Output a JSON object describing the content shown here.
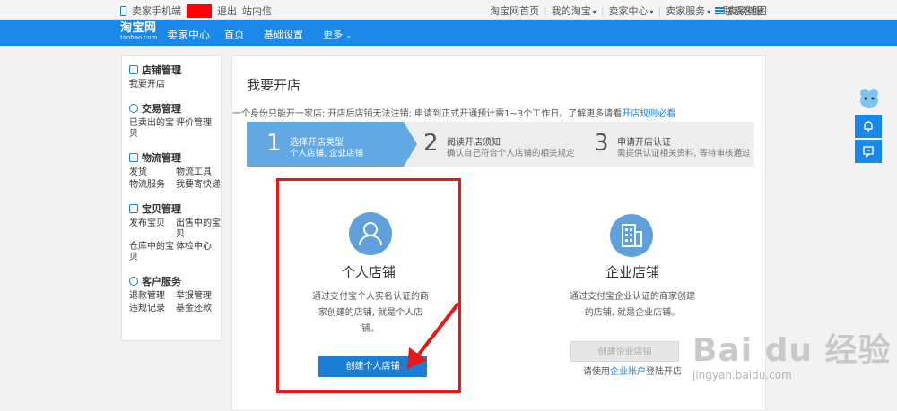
{
  "topbar": {
    "seller_mobile": "卖家手机端",
    "logout": "退出",
    "messages": "站内信",
    "links": [
      {
        "label": "淘宝网首页",
        "dropdown": false
      },
      {
        "label": "我的淘宝",
        "dropdown": true
      },
      {
        "label": "卖家中心",
        "dropdown": true
      },
      {
        "label": "卖家服务",
        "dropdown": true
      },
      {
        "label": "联系客服",
        "dropdown": false
      }
    ],
    "sitemap": "卖家地图"
  },
  "header": {
    "logo_cn": "淘宝网",
    "logo_en": "taobao.com",
    "center_title": "卖家中心",
    "nav": {
      "home": "首页",
      "settings": "基础设置",
      "more": "更多"
    }
  },
  "sidebar": {
    "store": {
      "title": "店铺管理",
      "links": [
        "我要开店"
      ]
    },
    "trade": {
      "title": "交易管理",
      "links": [
        "已卖出的宝贝",
        "评价管理"
      ]
    },
    "logistics": {
      "title": "物流管理",
      "links": [
        "发货",
        "物流工具",
        "物流服务",
        "我要寄快递"
      ]
    },
    "goods": {
      "title": "宝贝管理",
      "links": [
        "发布宝贝",
        "出售中的宝贝",
        "仓库中的宝贝",
        "体检中心"
      ]
    },
    "customer": {
      "title": "客户服务",
      "links": [
        "退款管理",
        "举报管理",
        "违规记录",
        "基金还款"
      ]
    }
  },
  "main": {
    "title": "我要开店",
    "notice": "一个身份只能开一家店; 开店后店铺无法注销; 申请到正式开通预计需1~3个工作日。了解更多请看",
    "notice_link": "开店规则必看",
    "steps": [
      {
        "num": "1",
        "title": "选择开店类型",
        "desc": "个人店铺, 企业店铺"
      },
      {
        "num": "2",
        "title": "阅读开店须知",
        "desc": "确认自己符合个人店铺的相关规定"
      },
      {
        "num": "3",
        "title": "申请开店认证",
        "desc": "需提供认证相关资料, 等待审核通过"
      }
    ],
    "personal": {
      "title": "个人店铺",
      "desc": "通过支付宝个人实名认证的商家创建的店铺, 就是个人店铺。",
      "button": "创建个人店铺"
    },
    "company": {
      "title": "企业店铺",
      "desc": "通过支付宝企业认证的商家创建的店铺, 就是企业店铺。",
      "button": "创建企业店铺",
      "hint_prefix": "请使用",
      "hint_link": "企业账户",
      "hint_suffix": "登陆开店"
    }
  },
  "watermark": {
    "brand": "Bai du 经验",
    "url": "jingyan.baidu.com"
  },
  "colors": {
    "brand_blue": "#1a88e8",
    "link_blue": "#1a7fd4",
    "highlight_red": "#e81818",
    "step_active": "#62a9e3",
    "step_inactive": "#ededed"
  }
}
